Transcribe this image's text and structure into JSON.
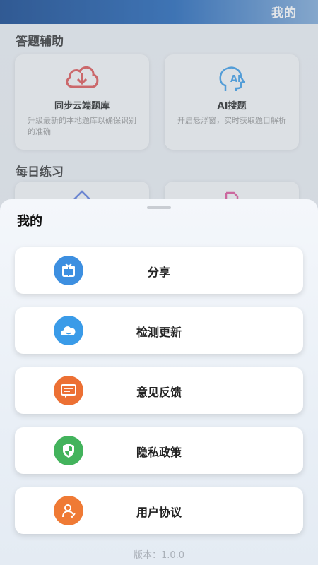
{
  "header": {
    "title": "我的"
  },
  "sections": [
    {
      "title": "答题辅助"
    },
    {
      "title": "每日练习"
    }
  ],
  "cards": [
    {
      "title": "同步云端题库",
      "desc": "升级最新的本地题库以确保识别的准确",
      "icon": "cloud-download-icon"
    },
    {
      "title": "AI搜题",
      "desc": "开启悬浮窗，实时获取题目解析",
      "icon": "ai-head-icon"
    }
  ],
  "sheet": {
    "title": "我的",
    "items": [
      {
        "label": "分享",
        "icon": "gift-icon",
        "color": "#3d8fe0"
      },
      {
        "label": "检测更新",
        "icon": "cloud-icon",
        "color": "#3a9be8"
      },
      {
        "label": "意见反馈",
        "icon": "feedback-icon",
        "color": "#ec7034"
      },
      {
        "label": "隐私政策",
        "icon": "shield-icon",
        "color": "#43b35c"
      },
      {
        "label": "用户协议",
        "icon": "user-icon",
        "color": "#ef7a35"
      }
    ],
    "version": "版本：1.0.0"
  }
}
